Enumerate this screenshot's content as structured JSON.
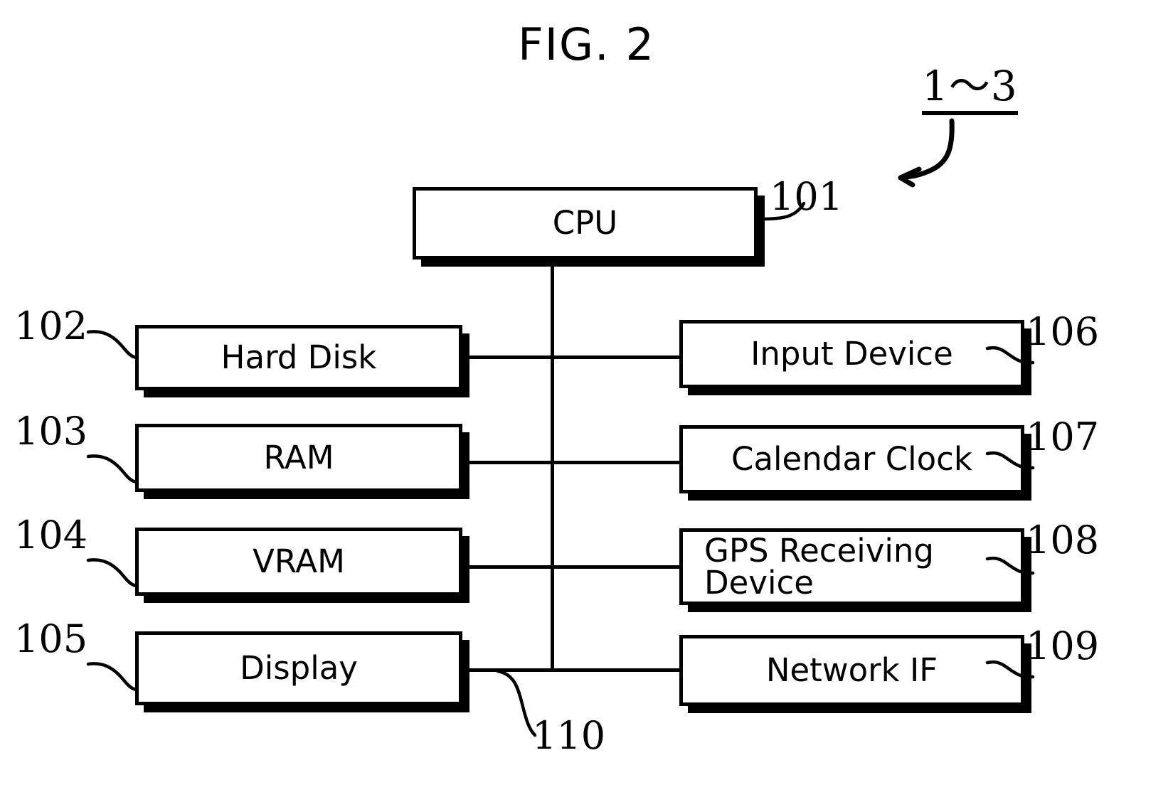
{
  "figure": {
    "title": "FIG. 2",
    "system_reference": "1～3",
    "type": "patent-block-diagram"
  },
  "blocks": [
    {
      "id": "cpu",
      "label": "CPU",
      "ref": "101"
    },
    {
      "id": "harddisk",
      "label": "Hard Disk",
      "ref": "102"
    },
    {
      "id": "ram",
      "label": "RAM",
      "ref": "103"
    },
    {
      "id": "vram",
      "label": "VRAM",
      "ref": "104"
    },
    {
      "id": "display",
      "label": "Display",
      "ref": "105"
    },
    {
      "id": "input",
      "label": "Input Device",
      "ref": "106"
    },
    {
      "id": "clock",
      "label": "Calendar Clock",
      "ref": "107"
    },
    {
      "id": "gps",
      "label": "GPS Receiving\nDevice",
      "ref": "108"
    },
    {
      "id": "network",
      "label": "Network IF",
      "ref": "109"
    }
  ],
  "bus": {
    "label": "110",
    "name": "system-bus"
  },
  "colors": {
    "ink": "#000000",
    "paper": "#ffffff"
  }
}
